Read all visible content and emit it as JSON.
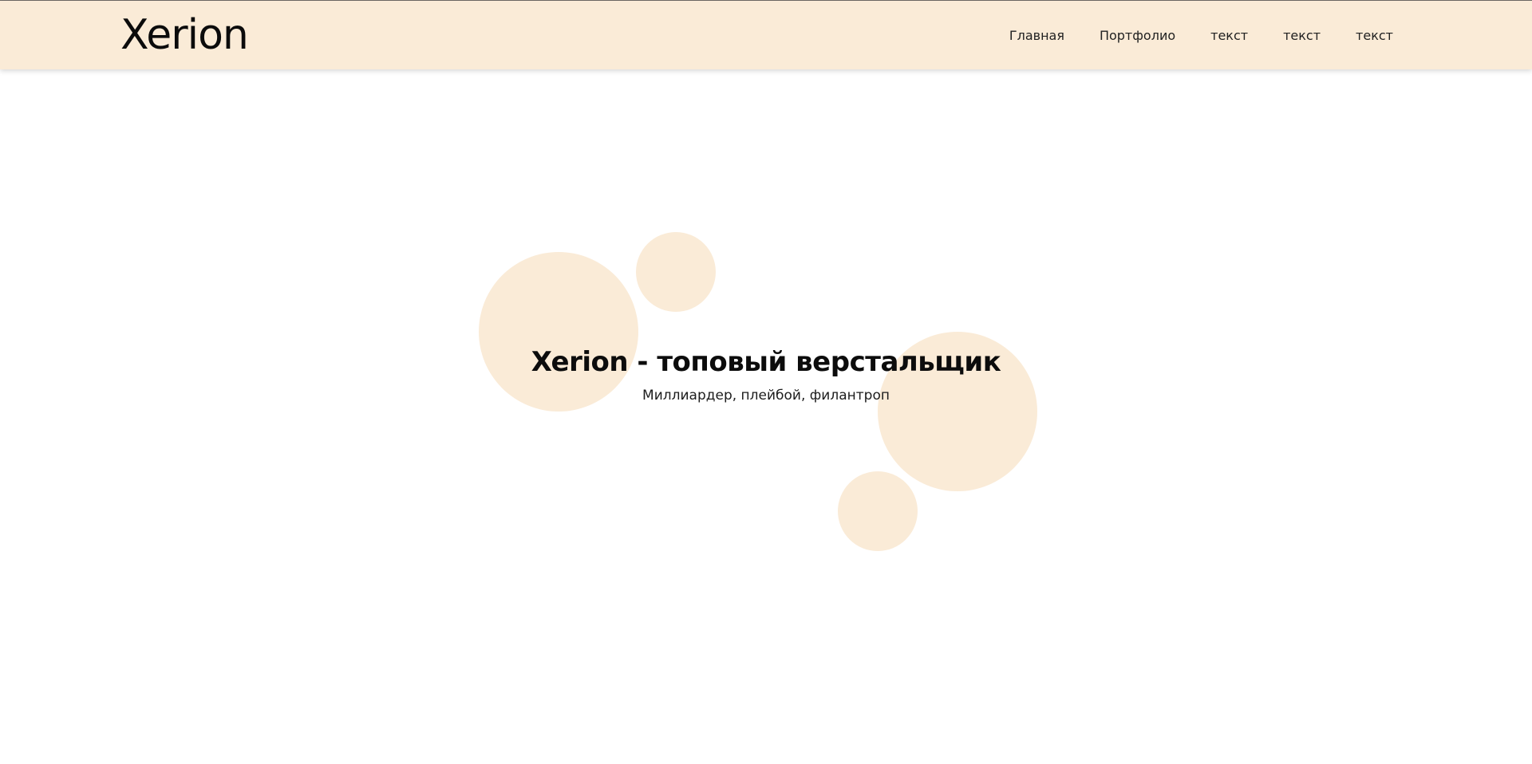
{
  "header": {
    "logo": "Xerion",
    "nav": [
      {
        "label": "Главная"
      },
      {
        "label": "Портфолио"
      },
      {
        "label": "текст"
      },
      {
        "label": "текст"
      },
      {
        "label": "текст"
      }
    ]
  },
  "hero": {
    "title": "Xerion - топовый верстальщик",
    "subtitle": "Миллиардер, плейбой, филантроп"
  },
  "colors": {
    "header_bg": "#faebd7",
    "circle_bg": "#faebd7",
    "page_bg": "#ffffff",
    "text": "#111111"
  }
}
